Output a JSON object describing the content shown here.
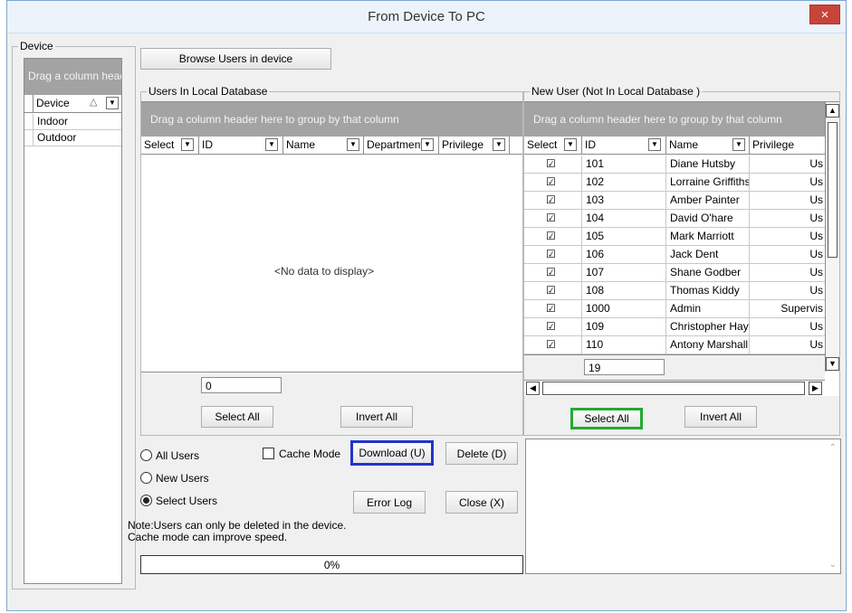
{
  "window": {
    "title": "From Device To PC",
    "close_label": "×"
  },
  "device_panel": {
    "group_label": "Device",
    "group_hint": "Drag a column header here to group by that column",
    "column": "Device",
    "sort_indicator": "△",
    "rows": [
      "Indoor",
      "Outdoor"
    ]
  },
  "browse_button": "Browse Users in device",
  "local_db": {
    "group_label": "Users In Local Database",
    "group_hint": "Drag a column header here to group by that column",
    "columns": [
      "Select",
      "ID",
      "Name",
      "Department",
      "Privilege"
    ],
    "empty_text": "<No data to display>",
    "count": "0",
    "select_all": "Select All",
    "invert_all": "Invert All"
  },
  "new_user": {
    "group_label": "New User (Not In Local Database )",
    "group_hint": "Drag a column header here to group by that column",
    "columns": [
      "Select",
      "ID",
      "Name",
      "Privilege"
    ],
    "rows": [
      {
        "checked": true,
        "id": "101",
        "name": "Diane Hutsby",
        "privilege": "Us"
      },
      {
        "checked": true,
        "id": "102",
        "name": "Lorraine Griffiths",
        "privilege": "Us"
      },
      {
        "checked": true,
        "id": "103",
        "name": "Amber Painter",
        "privilege": "Us"
      },
      {
        "checked": true,
        "id": "104",
        "name": "David O'hare",
        "privilege": "Us"
      },
      {
        "checked": true,
        "id": "105",
        "name": "Mark Marriott",
        "privilege": "Us"
      },
      {
        "checked": true,
        "id": "106",
        "name": "Jack Dent",
        "privilege": "Us"
      },
      {
        "checked": true,
        "id": "107",
        "name": "Shane Godber",
        "privilege": "Us"
      },
      {
        "checked": true,
        "id": "108",
        "name": "Thomas Kiddy",
        "privilege": "Us"
      },
      {
        "checked": true,
        "id": "1000",
        "name": "Admin",
        "privilege": "Supervis"
      },
      {
        "checked": true,
        "id": "109",
        "name": "Christopher Haye",
        "privilege": "Us"
      },
      {
        "checked": true,
        "id": "110",
        "name": "Antony Marshall",
        "privilege": "Us"
      }
    ],
    "count": "19",
    "select_all": "Select All",
    "invert_all": "Invert All"
  },
  "options": {
    "all_users": "All Users",
    "new_users": "New Users",
    "select_users": "Select Users",
    "selected": "select_users",
    "cache_mode": "Cache Mode",
    "cache_mode_checked": false
  },
  "actions": {
    "download": "Download (U)",
    "delete": "Delete (D)",
    "error_log": "Error Log",
    "close": "Close (X)"
  },
  "note_line1": "Note:Users can only be deleted in the device.",
  "note_line2": "Cache mode can improve speed.",
  "progress": {
    "text": "0%",
    "value": 0
  },
  "colors": {
    "download_highlight": "#2233cc",
    "select_all_highlight": "#22aa33"
  }
}
